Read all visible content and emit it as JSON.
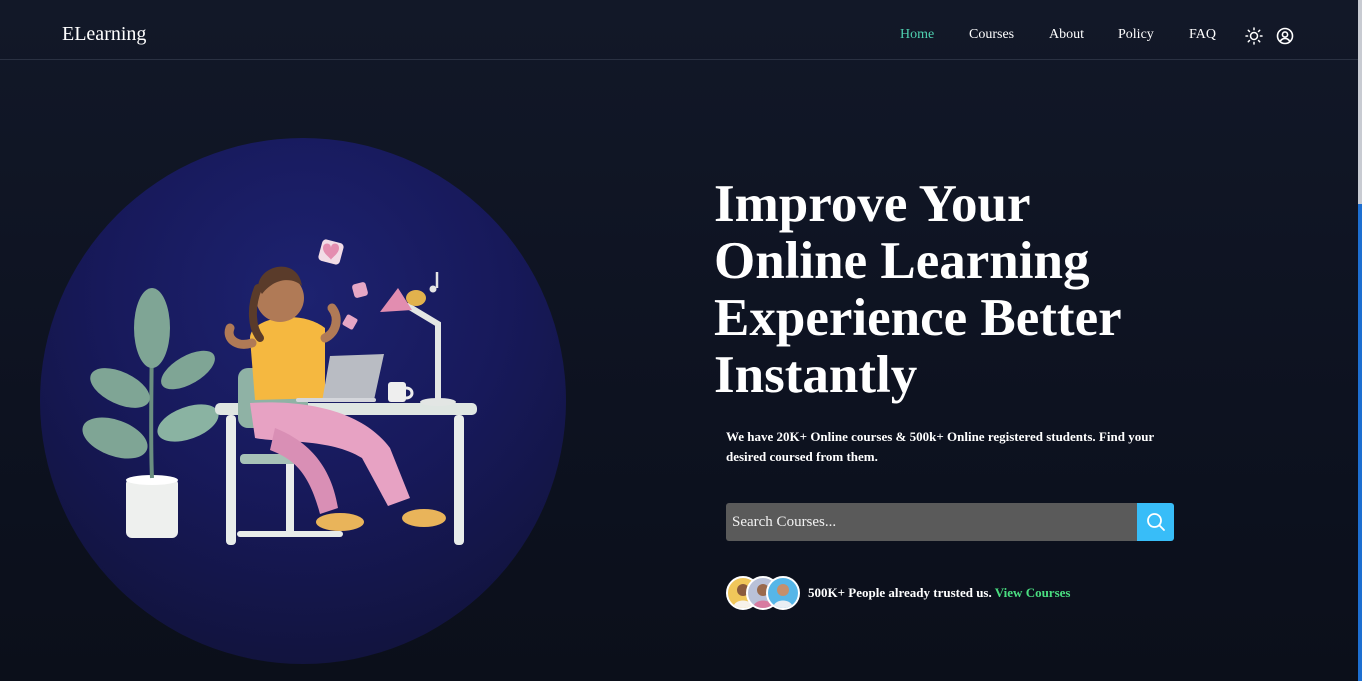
{
  "brand": "ELearning",
  "nav": {
    "items": [
      {
        "label": "Home",
        "active": true
      },
      {
        "label": "Courses",
        "active": false
      },
      {
        "label": "About",
        "active": false
      },
      {
        "label": "Policy",
        "active": false
      },
      {
        "label": "FAQ",
        "active": false
      }
    ],
    "icons": [
      "sun-icon",
      "user-circle-icon"
    ]
  },
  "hero": {
    "headline": "Improve Your Online Learning Experience Better Instantly",
    "subtext": "We have 20K+ Online courses & 500k+ Online registered students. Find your desired coursed from them.",
    "search": {
      "placeholder": "Search Courses...",
      "value": ""
    },
    "trust_text": "500K+ People already trusted us.",
    "trust_link": "View Courses"
  },
  "colors": {
    "accent": "#4fd1b0",
    "search_button": "#38bdf8",
    "link_green": "#4ade80",
    "background": "#111827",
    "circle": "#1d2270"
  }
}
